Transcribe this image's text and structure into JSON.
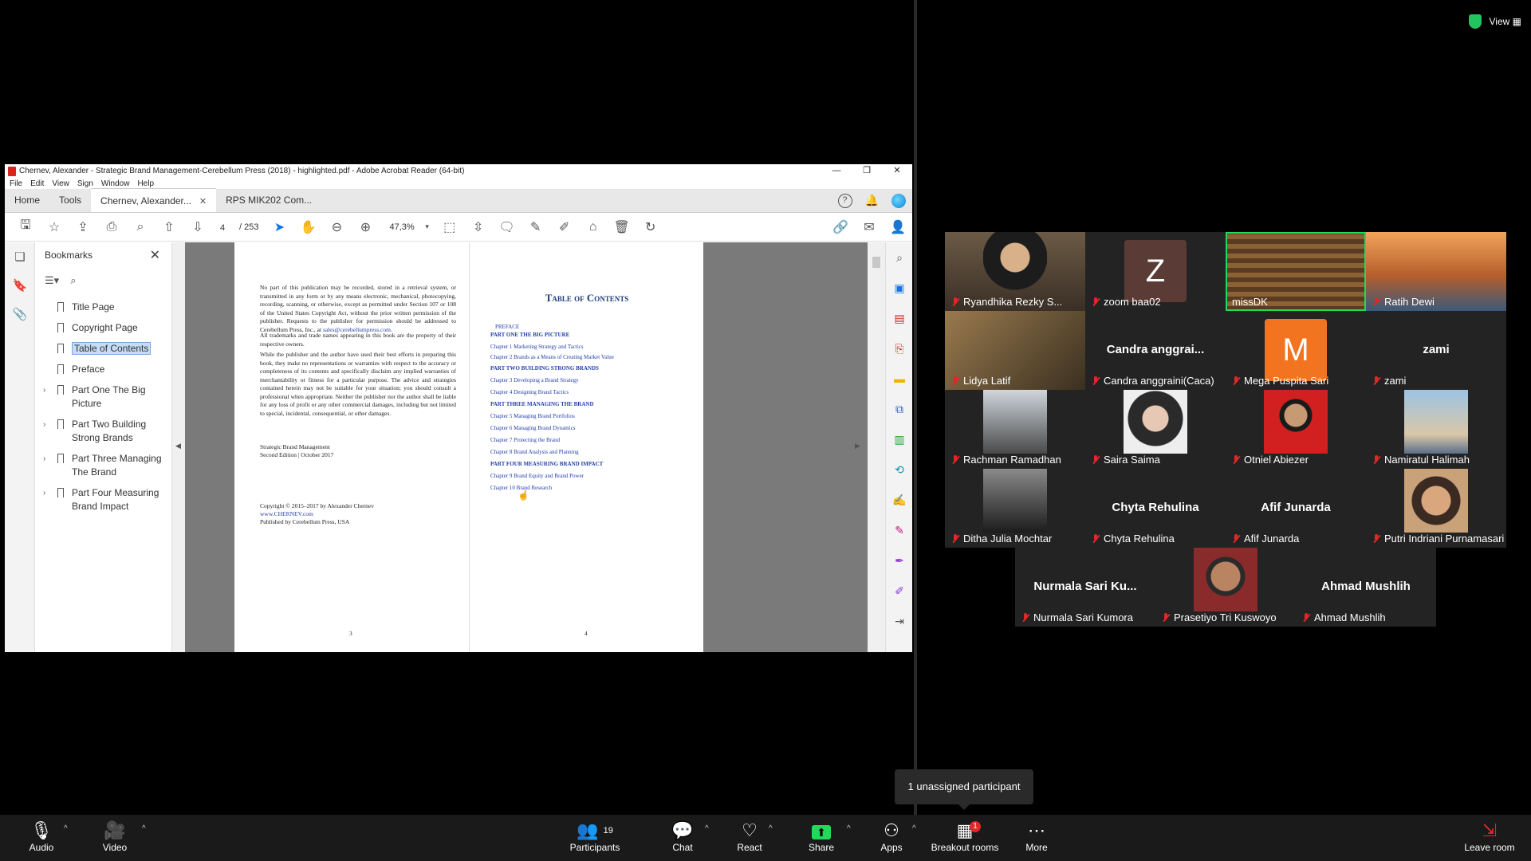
{
  "acrobat": {
    "window_title": "Chernev, Alexander - Strategic Brand Management-Cerebellum Press (2018) - highlighted.pdf - Adobe Acrobat Reader (64-bit)",
    "menu": [
      "File",
      "Edit",
      "View",
      "Sign",
      "Window",
      "Help"
    ],
    "tabs": {
      "home": "Home",
      "tools": "Tools",
      "doc1": "Chernev, Alexander...",
      "doc2": "RPS MIK202 Com..."
    },
    "page_current": "4",
    "page_total": "/ 253",
    "zoom": "47,3%",
    "bookmarks_title": "Bookmarks",
    "bookmarks": [
      "Title Page",
      "Copyright Page",
      "Table of Contents",
      "Preface",
      "Part One The Big Picture",
      "Part Two Building Strong Brands",
      "Part Three Managing The Brand",
      "Part Four Measuring Brand Impact"
    ],
    "left_page": {
      "p1": "No part of this publication may be recorded, stored in a retrieval system, or transmitted in any form or by any means electronic, mechanical, photocopying, recording, scanning, or otherwise, except as permitted under Section 107 or 108 of the United States Copyright Act, without the prior written permission of the publisher. Requests to the publisher for permission should be addressed to Cerebellum Press, Inc., at",
      "email": "sales@cerebellumpress.com.",
      "p2": "All trademarks and trade names appearing in this book are the property of their respective owners.",
      "p3": "While the publisher and the author have used their best efforts in preparing this book, they make no representations or warranties with respect to the accuracy or completeness of its contents and specifically disclaim any implied warranties of merchantability or fitness for a particular purpose. The advice and strategies contained herein may not be suitable for your situation; you should consult a professional when appropriate. Neither the publisher nor the author shall be liable for any loss of profit or any other commercial damages, including but not limited to special, incidental, consequential, or other damages.",
      "ed1": "Strategic Brand Management",
      "ed2": "Second Edition | October 2017",
      "c1": "Copyright © 2015–2017 by Alexander Chernev",
      "c2": "www.CHERNEV.com",
      "c3": "Published by Cerebellum Press, USA",
      "num": "3"
    },
    "right_page": {
      "heading": "Table of Contents",
      "toc": [
        "PREFACE",
        "PART ONE THE BIG PICTURE",
        "Chapter 1 Marketing Strategy and Tactics",
        "Chapter 2 Brands as a Means of Creating Market Value",
        "PART TWO BUILDING STRONG BRANDS",
        "Chapter 3 Developing a Brand Strategy",
        "Chapter 4 Designing Brand Tactics",
        "PART THREE MANAGING THE BRAND",
        "Chapter 5 Managing Brand Portfolios",
        "Chapter 6 Managing Brand Dynamics",
        "Chapter 7 Protecting the Brand",
        "Chapter 8 Brand Analysis and Planning",
        "PART FOUR MEASURING BRAND IMPACT",
        "Chapter 9 Brand Equity and Brand Power",
        "Chapter 10 Brand Research"
      ],
      "num": "4"
    }
  },
  "gallery": {
    "r1": [
      "Ryandhika Rezky S...",
      "zoom baa02",
      "missDK",
      "Ratih Dewi"
    ],
    "r2": [
      "Lidya Latif",
      "Candra anggraini(Caca)",
      "Mega Puspita Sari",
      "zami"
    ],
    "r2big": [
      "Candra anggrai...",
      "zami"
    ],
    "avatar_z": "Z",
    "avatar_m": "M",
    "r3": [
      "Rachman Ramadhan",
      "Saira Saima",
      "Otniel Abiezer",
      "Namiratul Halimah"
    ],
    "r4": [
      "Ditha Julia Mochtar",
      "Chyta Rehulina",
      "Afif Junarda",
      "Putri Indriani Purnamasari"
    ],
    "r4big": [
      "Chyta Rehulina",
      "Afif Junarda"
    ],
    "r5": [
      "Nurmala Sari Kumora",
      "Prasetiyo Tri Kuswoyo",
      "Ahmad Mushlih"
    ],
    "r5big": [
      "Nurmala Sari Ku...",
      "Ahmad Mushlih"
    ]
  },
  "topright": {
    "view": "View"
  },
  "tooltip": "1 unassigned participant",
  "controls": {
    "audio": "Audio",
    "video": "Video",
    "participants": "Participants",
    "participants_count": "19",
    "chat": "Chat",
    "react": "React",
    "share": "Share",
    "apps": "Apps",
    "breakout": "Breakout rooms",
    "breakout_badge": "1",
    "more": "More",
    "leave": "Leave room"
  },
  "colors": {
    "speaking": "#23d959",
    "muted": "#e02828",
    "share_green": "#23d959",
    "avatar_z": "#5a3b35",
    "avatar_m": "#f27420"
  }
}
